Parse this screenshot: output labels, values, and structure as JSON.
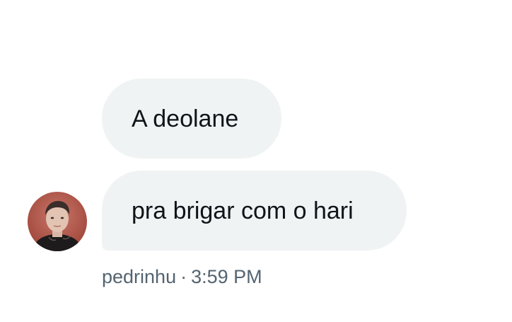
{
  "conversation": {
    "messages": [
      {
        "text": "A deolane"
      },
      {
        "text": "pra brigar com o hari"
      }
    ],
    "meta": {
      "sender": "pedrinhu",
      "separator": "·",
      "time": "3:59 PM"
    }
  },
  "colors": {
    "bubble_background": "#eff3f4",
    "message_text": "#0f1419",
    "meta_text": "#536471",
    "avatar_background": "#b85a4e"
  }
}
